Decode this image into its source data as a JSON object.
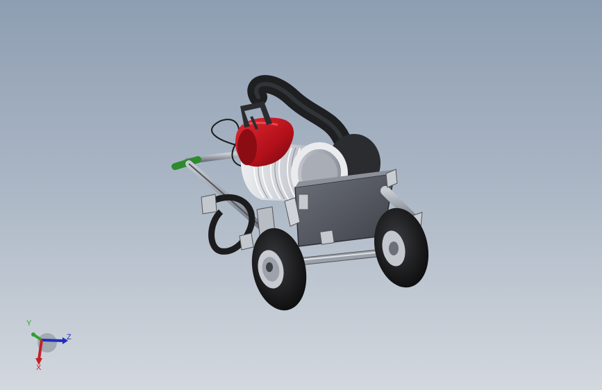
{
  "viewport": {
    "background_top": "#8e9eb2",
    "background_bottom": "#d3d8de"
  },
  "model": {
    "parts": [
      "frame-handle",
      "grip",
      "hose",
      "red-cap",
      "carry-handle",
      "hose-reel",
      "front-plate",
      "wheel-left",
      "wheel-right",
      "axle",
      "hose-hook",
      "cable"
    ],
    "colors": {
      "frame": "#7d828c",
      "grip": "#2d8a2d",
      "hose": "#222426",
      "red_cap": "#b3101a",
      "reel": "#c9ccd2",
      "tire": "#1c1c1e",
      "hub": "#b9bdc4",
      "plate": "#5b5f68"
    }
  },
  "triad": {
    "y_label": "Y",
    "z_label": "Z",
    "x_label": "X",
    "y_color": "#2ea02e",
    "z_color": "#1f2fbf",
    "x_color": "#c0202a"
  }
}
